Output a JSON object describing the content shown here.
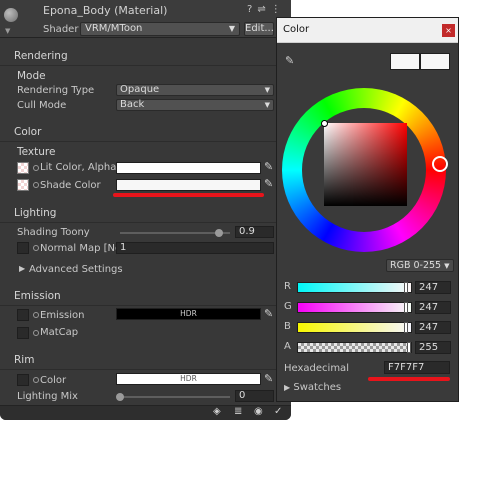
{
  "inspector": {
    "title": "Epona_Body (Material)",
    "shader_label": "Shader",
    "shader_value": "VRM/MToon",
    "edit_button": "Edit...",
    "header_icons": [
      "?",
      "⇌",
      "⋮"
    ],
    "sections": {
      "rendering": "Rendering",
      "mode": "Mode",
      "color": "Color",
      "texture": "Texture",
      "lighting": "Lighting",
      "emission": "Emission",
      "rim": "Rim"
    },
    "rendering_type_label": "Rendering Type",
    "rendering_type_value": "Opaque",
    "cull_mode_label": "Cull Mode",
    "cull_mode_value": "Back",
    "lit_color_label": "Lit Color, Alpha",
    "shade_color_label": "Shade Color",
    "shading_toony_label": "Shading Toony",
    "shading_toony_value": "0.9",
    "shading_toony_fraction": 0.9,
    "normal_map_label": "Normal Map [Non",
    "normal_map_value": "1",
    "advanced_settings": "Advanced Settings",
    "emission_label": "Emission",
    "hdr": "HDR",
    "matcap_label": "MatCap",
    "rim_color_label": "Color",
    "lighting_mix_label": "Lighting Mix",
    "lighting_mix_value": "0",
    "lighting_mix_fraction": 0.0
  },
  "color_window": {
    "title": "Color",
    "close": "×",
    "mode": "RGB 0-255",
    "channels": [
      {
        "label": "R",
        "value": "247"
      },
      {
        "label": "G",
        "value": "247"
      },
      {
        "label": "B",
        "value": "247"
      },
      {
        "label": "A",
        "value": "255"
      }
    ],
    "hex_label": "Hexadecimal",
    "hex_value": "F7F7F7",
    "swatches_label": "Swatches",
    "current_color": "#F7F7F7"
  },
  "colors": {
    "panel_bg": "#383838",
    "annotation_red": "#E8141B",
    "hue": "#FF0000"
  }
}
